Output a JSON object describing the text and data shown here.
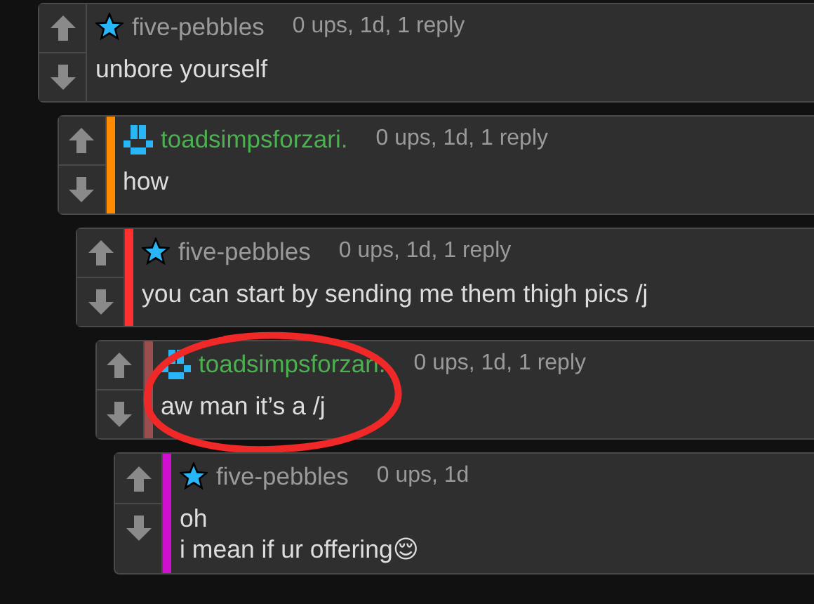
{
  "comments": [
    {
      "user": {
        "name": "five-pebbles",
        "kind": "star",
        "color": "#9a9a9a"
      },
      "meta": "0 ups, 1d, 1 reply",
      "text": "unbore yourself",
      "circled": false,
      "children": [
        {
          "user": {
            "name": "toadsimpsforzari.",
            "kind": "pixel",
            "color": "#4caf50"
          },
          "meta": "0 ups, 1d, 1 reply",
          "text": "how",
          "color": "#ff8c00",
          "circled": false,
          "children": [
            {
              "user": {
                "name": "five-pebbles",
                "kind": "star",
                "color": "#9a9a9a"
              },
              "meta": "0 ups, 1d, 1 reply",
              "text": "you can start by sending me them thigh pics /j",
              "color": "#ff3030",
              "circled": false,
              "children": [
                {
                  "user": {
                    "name": "toadsimpsforzari.",
                    "kind": "pixel",
                    "color": "#4caf50"
                  },
                  "meta": "0 ups, 1d, 1 reply",
                  "text": "aw man it’s a /j",
                  "color": "#9a4e4e",
                  "circled": true,
                  "children": [
                    {
                      "user": {
                        "name": "five-pebbles",
                        "kind": "star",
                        "color": "#9a9a9a"
                      },
                      "meta": "0 ups, 1d",
                      "text": "oh\ni mean if ur offering😌",
                      "color": "#d010d0",
                      "circled": false
                    }
                  ]
                }
              ]
            }
          ]
        }
      ]
    }
  ]
}
